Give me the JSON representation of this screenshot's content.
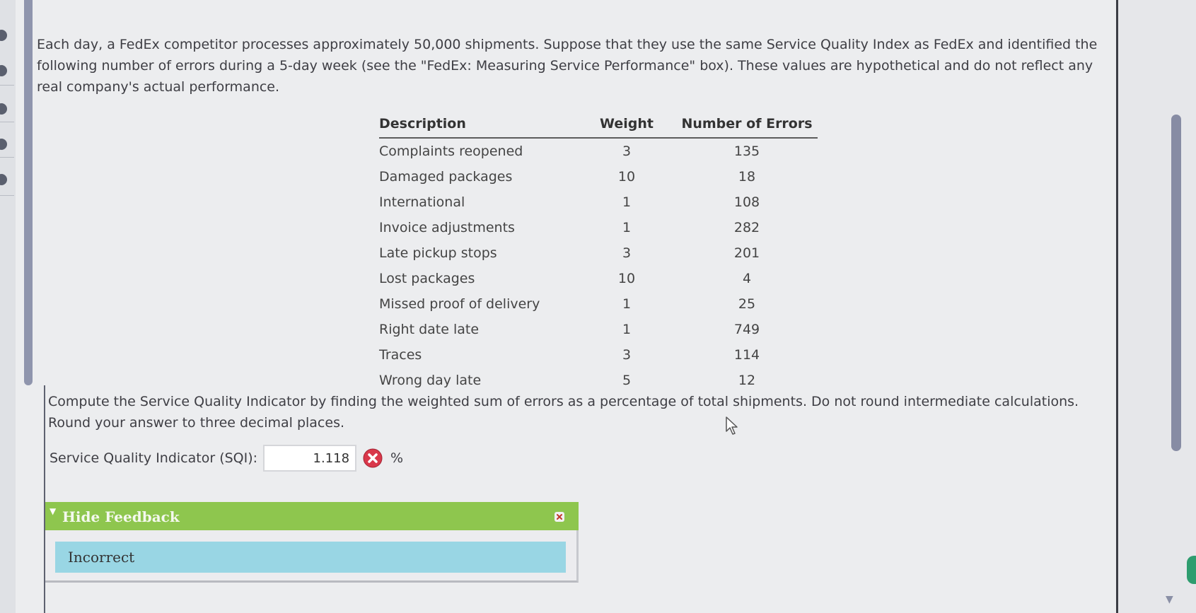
{
  "problem": {
    "intro": "Each day, a FedEx competitor processes approximately 50,000 shipments. Suppose that they use the same Service Quality Index as FedEx and identified the following number of errors during a 5-day week (see the \"FedEx: Measuring Service Performance\" box). These values are hypothetical and do not reflect any real company's actual performance."
  },
  "table": {
    "headers": [
      "Description",
      "Weight",
      "Number of Errors"
    ],
    "rows": [
      {
        "description": "Complaints reopened",
        "weight": "3",
        "errors": "135"
      },
      {
        "description": "Damaged packages",
        "weight": "10",
        "errors": "18"
      },
      {
        "description": "International",
        "weight": "1",
        "errors": "108"
      },
      {
        "description": "Invoice adjustments",
        "weight": "1",
        "errors": "282"
      },
      {
        "description": "Late pickup stops",
        "weight": "3",
        "errors": "201"
      },
      {
        "description": "Lost packages",
        "weight": "10",
        "errors": "4"
      },
      {
        "description": "Missed proof of delivery",
        "weight": "1",
        "errors": "25"
      },
      {
        "description": "Right date late",
        "weight": "1",
        "errors": "749"
      },
      {
        "description": "Traces",
        "weight": "3",
        "errors": "114"
      },
      {
        "description": "Wrong day late",
        "weight": "5",
        "errors": "12"
      }
    ]
  },
  "instructions": "Compute the Service Quality Indicator by finding the weighted sum of errors as a percentage of total shipments. Do not round intermediate calculations. Round your answer to three decimal places.",
  "answer": {
    "label": "Service Quality Indicator (SQI):",
    "value": "1.118",
    "unit": "%",
    "status_icon": "incorrect-x-icon"
  },
  "feedback": {
    "toggle_label": "Hide Feedback",
    "message": "Incorrect",
    "header_color": "#8ec64e",
    "body_color": "#99d6e4"
  }
}
